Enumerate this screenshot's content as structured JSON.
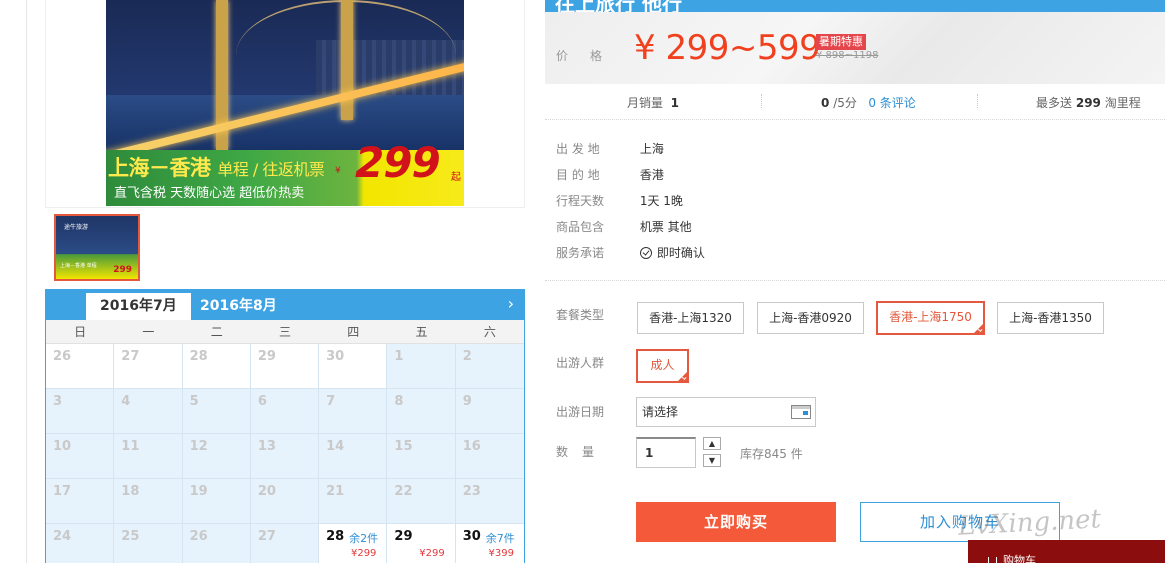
{
  "gallery": {
    "banner": {
      "title": "上海－香港",
      "subtitle": "单程 / 往返机票",
      "line2": "直飞含税 天数随心选 超低价热卖",
      "currency": "¥",
      "price": "299",
      "suffix": "起"
    },
    "thumbnail": {
      "logo_text": "途牛旅游",
      "line": "上海－香港 单程",
      "price": "299"
    }
  },
  "calendar": {
    "tabs": [
      "2016年7月",
      "2016年8月"
    ],
    "next_icon": "chevron-right-icon",
    "weekdays": [
      "日",
      "一",
      "二",
      "三",
      "四",
      "五",
      "六"
    ],
    "days": [
      {
        "num": "26",
        "other": true
      },
      {
        "num": "27",
        "other": true
      },
      {
        "num": "28",
        "other": true
      },
      {
        "num": "29",
        "other": true
      },
      {
        "num": "30",
        "other": true
      },
      {
        "num": "1"
      },
      {
        "num": "2"
      },
      {
        "num": "3"
      },
      {
        "num": "4"
      },
      {
        "num": "5"
      },
      {
        "num": "6"
      },
      {
        "num": "7"
      },
      {
        "num": "8"
      },
      {
        "num": "9"
      },
      {
        "num": "10"
      },
      {
        "num": "11"
      },
      {
        "num": "12"
      },
      {
        "num": "13"
      },
      {
        "num": "14"
      },
      {
        "num": "15"
      },
      {
        "num": "16"
      },
      {
        "num": "17"
      },
      {
        "num": "18"
      },
      {
        "num": "19"
      },
      {
        "num": "20"
      },
      {
        "num": "21"
      },
      {
        "num": "22"
      },
      {
        "num": "23"
      },
      {
        "num": "24"
      },
      {
        "num": "25"
      },
      {
        "num": "26"
      },
      {
        "num": "27"
      },
      {
        "num": "28",
        "avail": true,
        "left": "余2件",
        "price": "¥299"
      },
      {
        "num": "29",
        "avail": true,
        "left": "",
        "price": "¥299"
      },
      {
        "num": "30",
        "avail": true,
        "left": "余7件",
        "price": "¥399"
      }
    ]
  },
  "product": {
    "title_fragment": "往上旅行 他行",
    "price_label": "价格",
    "price_range": "¥ 299~599",
    "promo_badge": "暑期特惠",
    "original_price": "¥ 898~1198",
    "stats": {
      "monthly_sales_label": "月销量",
      "monthly_sales": "1",
      "rating": "0",
      "rating_suffix": "/5分",
      "reviews": "0 条评论",
      "miles_prefix": "最多送",
      "miles": "299",
      "miles_suffix": "淘里程"
    },
    "info": [
      {
        "label": "出 发 地",
        "value": "上海"
      },
      {
        "label": "目 的 地",
        "value": "香港"
      },
      {
        "label": "行程天数",
        "value": "1天 1晚"
      },
      {
        "label": "商品包含",
        "value": "机票  其他"
      },
      {
        "label": "服务承诺",
        "value": "即时确认"
      }
    ]
  },
  "options": {
    "package_label": "套餐类型",
    "packages": [
      "香港-上海1320",
      "上海-香港0920",
      "香港-上海1750",
      "上海-香港1350"
    ],
    "selected_package": "香港-上海1750",
    "group_label": "出游人群",
    "group_value": "成人",
    "date_label": "出游日期",
    "date_placeholder": "请选择",
    "qty_label": "数　量",
    "qty_value": "1",
    "stock": "库存845 件",
    "buy_now": "立即购买",
    "add_to_cart": "加入购物车",
    "float_cart": "购物车"
  },
  "watermark": "LvXing.net",
  "colors": {
    "accent_blue": "#3ea3e3",
    "price_red": "#f0401e",
    "buy_button": "#f45a3a",
    "selected_border": "#e4593d"
  }
}
